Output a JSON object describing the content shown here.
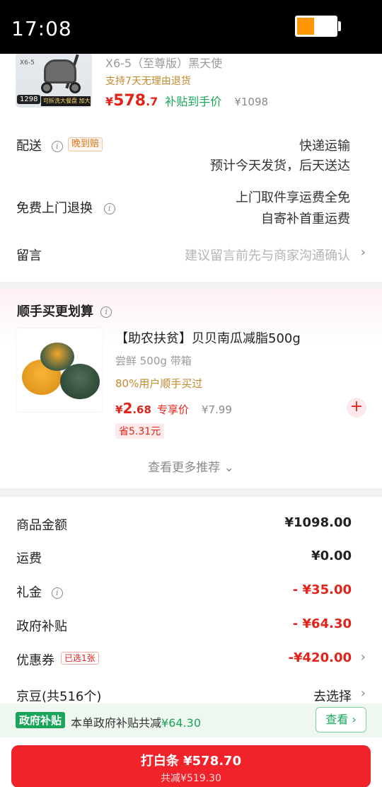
{
  "status_bar": {
    "time": "17:08",
    "battery_level": 0.45,
    "battery_color": "#ff9500"
  },
  "product": {
    "thumb_badge": "1298",
    "thumb_strip": "可拆洗大餐盘 加大置物篮",
    "thumb_label": "X6-5",
    "model": "X6-5（至尊版）黑天使",
    "return_policy": "支持7天无理由退货",
    "price_symbol": "¥",
    "price_int": "578",
    "price_dec": ".7",
    "subsidy_label": "补贴到手价",
    "original_price": "¥1098"
  },
  "delivery": {
    "label": "配送",
    "tag": "晚到赔",
    "method": "快递运输",
    "estimate": "预计今天发货，后天送达"
  },
  "return_service": {
    "label": "免费上门退换",
    "line1": "上门取件享运费全免",
    "line2": "自寄补首重运费"
  },
  "message": {
    "label": "留言",
    "placeholder": "建议留言前先与商家沟通确认"
  },
  "addon": {
    "title": "顺手买更划算",
    "item": {
      "name": "【助农扶贫】贝贝南瓜减脂500g",
      "spec": "尝鲜 500g 带箱",
      "bought": "80%用户顺手买过",
      "price_symbol": "¥",
      "price_int": "2",
      "price_dec": ".68",
      "vip_label": "专享价",
      "original_price": "¥7.99",
      "save": "省5.31元"
    },
    "more": "查看更多推荐"
  },
  "summary": {
    "goods_label": "商品金额",
    "goods_value": "¥1098.00",
    "shipping_label": "运费",
    "shipping_value": "¥0.00",
    "gift_label": "礼金",
    "gift_value": "- ¥35.00",
    "gov_label": "政府补贴",
    "gov_value": "- ¥64.30",
    "coupon_label": "优惠券",
    "coupon_tag": "已选1张",
    "coupon_value": "-¥420.00",
    "jd_beans_label": "京豆(共516个)",
    "jd_beans_action": "去选择"
  },
  "gov_bar": {
    "tag": "政府补贴",
    "text": "本单政府补贴共减",
    "amount": "¥64.30",
    "button": "查看"
  },
  "pay": {
    "main": "打白条 ¥578.70",
    "sub": "共减¥519.30"
  },
  "colors": {
    "accent_red": "#e2231a",
    "pay_red": "#f0232b",
    "green": "#1aa55a"
  }
}
